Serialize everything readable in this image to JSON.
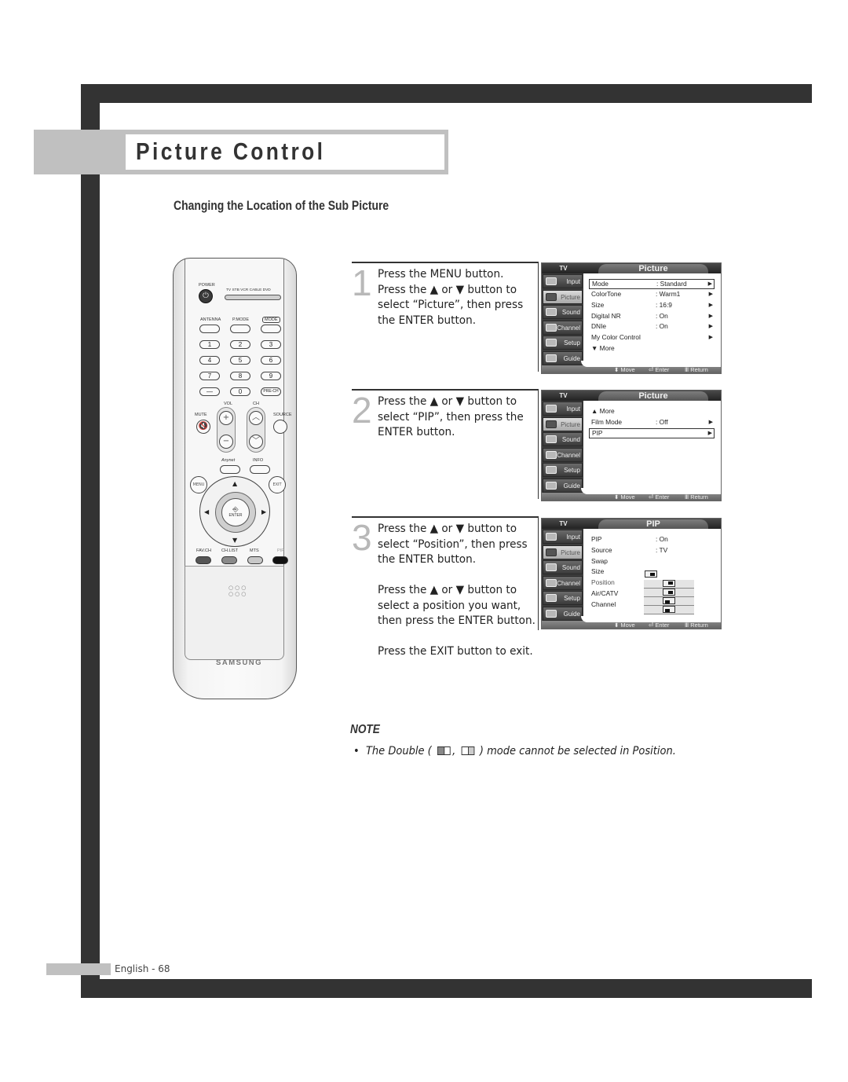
{
  "page": {
    "title": "Picture Control",
    "subtitle": "Changing the Location of the Sub Picture",
    "footer": "English - 68"
  },
  "remote": {
    "power_label": "POWER",
    "power_glyph": "⏻",
    "mode_labels": "TV  STB  VCR  CABLE  DVD",
    "antenna_label": "ANTENNA",
    "pmode_label": "P.MODE",
    "mode_label": "MODE",
    "keys": [
      "1",
      "2",
      "3",
      "4",
      "5",
      "6",
      "7",
      "8",
      "9",
      "—",
      "0",
      "PRE-CH"
    ],
    "vol_label": "VOL",
    "ch_label": "CH",
    "mute_label": "MUTE",
    "source_label": "SOURCE",
    "anynet_label": "Anynet",
    "info_label": "INFO",
    "menu_label": "MENU",
    "exit_label": "EXIT",
    "enter_label": "ENTER",
    "favch_label": "FAV.CH",
    "chlist_label": "CH.LIST",
    "mts_label": "MTS",
    "pip_label": "PIP",
    "brand": "SAMSUNG"
  },
  "steps": [
    {
      "number": "1",
      "lines": [
        "Press the MENU button.",
        "Press the ▲ or ▼ button to",
        "select “Picture”, then press",
        "the ENTER button."
      ]
    },
    {
      "number": "2",
      "lines": [
        "Press the ▲ or ▼ button to",
        "select “PIP”, then press the",
        "ENTER button."
      ]
    },
    {
      "number": "3",
      "lines": [
        "Press the ▲ or ▼ button to",
        "select “Position”, then press",
        "the ENTER button."
      ],
      "lines2": [
        "Press the ▲ or ▼ button to",
        "select a position you want,",
        "then press the ENTER button."
      ],
      "lines3": [
        "Press the EXIT button to exit."
      ]
    }
  ],
  "osd_common": {
    "tv_label": "TV",
    "sidebar": [
      "Input",
      "Picture",
      "Sound",
      "Channel",
      "Setup",
      "Guide"
    ],
    "footer": {
      "move": "Move",
      "enter": "Enter",
      "return": "Return",
      "move_glyph": "⬍",
      "enter_glyph": "⏎",
      "return_glyph": "Ⅲ"
    }
  },
  "osd_screens": [
    {
      "title": "Picture",
      "active_sidebar": "Picture",
      "rows": [
        {
          "label": "Mode",
          "value": ": Standard",
          "arrow": "▶",
          "selected": true
        },
        {
          "label": "ColorTone",
          "value": ": Warm1",
          "arrow": "▶"
        },
        {
          "label": "Size",
          "value": ": 16:9",
          "arrow": "▶"
        },
        {
          "label": "Digital NR",
          "value": ": On",
          "arrow": "▶"
        },
        {
          "label": "DNIe",
          "value": ": On",
          "arrow": "▶"
        },
        {
          "label": "My Color Control",
          "value": "",
          "arrow": "▶"
        },
        {
          "label": "▼ More",
          "value": "",
          "arrow": ""
        }
      ]
    },
    {
      "title": "Picture",
      "active_sidebar": "Picture",
      "rows": [
        {
          "label": "▲ More",
          "value": "",
          "arrow": ""
        },
        {
          "label": "Film Mode",
          "value": ": Off",
          "arrow": "▶"
        },
        {
          "label": "PIP",
          "value": "",
          "arrow": "▶",
          "selected": true
        }
      ]
    },
    {
      "title": "PIP",
      "active_sidebar": "Picture",
      "rows": [
        {
          "label": "PIP",
          "value": ": On",
          "arrow": ""
        },
        {
          "label": "Source",
          "value": ": TV",
          "arrow": ""
        },
        {
          "label": "Swap",
          "value": "",
          "arrow": ""
        },
        {
          "label": "Size",
          "value": "",
          "arrow": ""
        },
        {
          "label": "Position",
          "value": "",
          "arrow": "",
          "dim": true
        },
        {
          "label": "Air/CATV",
          "value": "",
          "arrow": ""
        },
        {
          "label": "Channel",
          "value": "",
          "arrow": ""
        }
      ],
      "position_options": [
        "top-right",
        "top-right-small",
        "bottom-left",
        "bottom-left-small"
      ]
    }
  ],
  "note": {
    "heading": "NOTE",
    "bullet": "•",
    "text_before": "The Double (",
    "text_comma": ",",
    "text_after": ") mode cannot be selected in Position."
  }
}
